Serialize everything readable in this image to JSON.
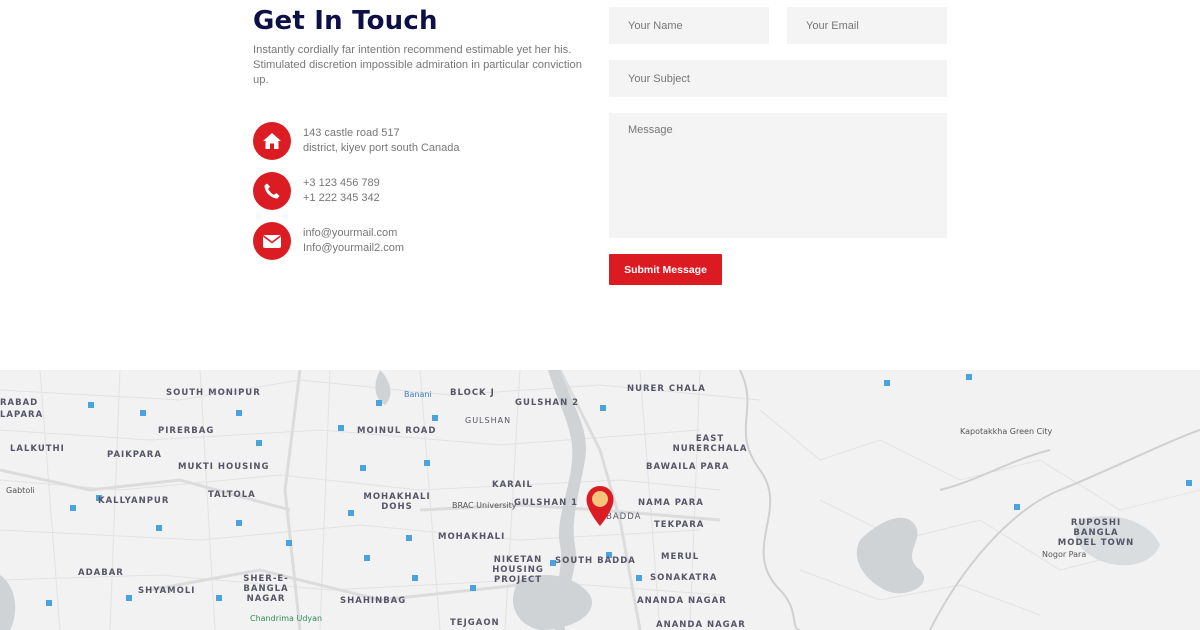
{
  "contact": {
    "title": "Get In Touch",
    "intro": "Instantly cordially far intention recommend estimable yet her his. Stimulated discretion impossible admiration in particular conviction up.",
    "address": {
      "icon": "home-icon",
      "line1": "143 castle road 517",
      "line2": "district, kiyev port south Canada"
    },
    "phone": {
      "icon": "phone-icon",
      "line1": "+3 123 456 789",
      "line2": "+1 222 345 342"
    },
    "email": {
      "icon": "envelope-icon",
      "line1": "info@yourmail.com",
      "line2": "Info@yourmail2.com"
    }
  },
  "form": {
    "name_placeholder": "Your Name",
    "email_placeholder": "Your Email",
    "subject_placeholder": "Your Subject",
    "message_placeholder": "Message",
    "submit_label": "Submit Message"
  },
  "map": {
    "labels": [
      "SOUTH MONIPUR",
      "BLOCK J",
      "GULSHAN 2",
      "NURER CHALA",
      "PIRERBAG",
      "MOINUL ROAD",
      "GULSHAN",
      "EAST NURERCHALA",
      "LALKUTHI",
      "PAIKPARA",
      "MUKTI HOUSING",
      "BAWAILA PARA",
      "KARAIL",
      "MOHAKHALI DOHS",
      "BRAC University",
      "GULSHAN 1",
      "NAMA PARA",
      "KALLYANPUR",
      "TALTOLA",
      "BADDA",
      "TEKPARA",
      "MOHAKHALI",
      "NIKETAN HOUSING PROJECT",
      "SOUTH BADDA",
      "MERUL",
      "ADABAR",
      "SHER-E-BANGLA NAGAR",
      "SONAKATRA",
      "SHYAMOLI",
      "SHAHINBAG",
      "ANANDA NAGAR",
      "Chandrima Udyan",
      "TEJGAON",
      "ANANDA NAGAR",
      "Kapotakkha Green City",
      "RUPOSHI BANGLA MODEL TOWN",
      "Nogor Para",
      "Gabtoli",
      "RABAD",
      "LAPARA",
      "Banani"
    ],
    "accent": "#dc1c23"
  },
  "colors": {
    "accent": "#dc1c23",
    "heading": "#0c1047",
    "field_bg": "#f4f4f4"
  }
}
